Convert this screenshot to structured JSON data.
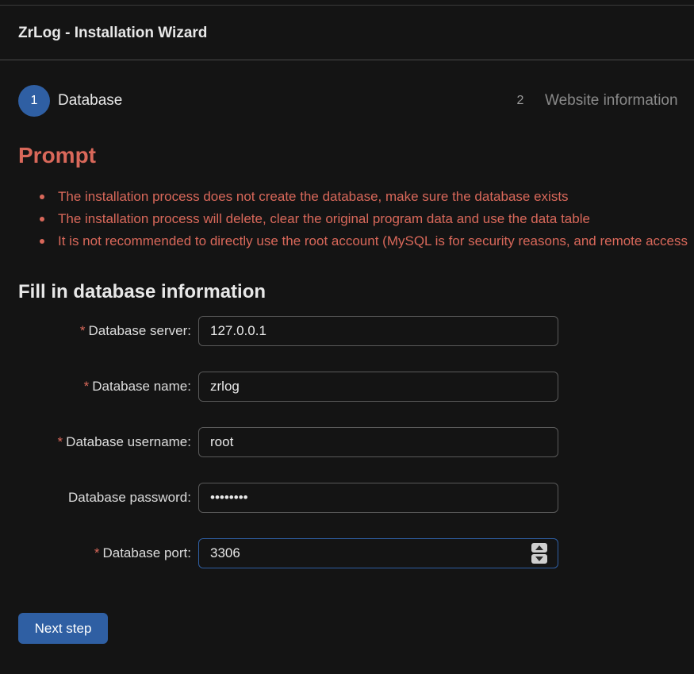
{
  "header": {
    "title": "ZrLog - Installation Wizard"
  },
  "steps": [
    {
      "number": "1",
      "label": "Database",
      "active": true
    },
    {
      "number": "2",
      "label": "Website information",
      "active": false
    }
  ],
  "prompt": {
    "title": "Prompt",
    "items": [
      "The installation process does not create the database, make sure the database exists",
      "The installation process will delete, clear the original program data and use the data table",
      "It is not recommended to directly use the root account (MySQL is for security reasons, and remote access"
    ]
  },
  "form": {
    "title": "Fill in database information",
    "required_mark": "*",
    "fields": {
      "server": {
        "label": "Database server",
        "value": "127.0.0.1",
        "required": true
      },
      "name": {
        "label": "Database name",
        "value": "zrlog",
        "required": true
      },
      "username": {
        "label": "Database username",
        "value": "root",
        "required": true
      },
      "password": {
        "label": "Database password",
        "value": "••••••••",
        "required": false
      },
      "port": {
        "label": "Database port",
        "value": "3306",
        "required": true
      }
    },
    "label_suffix": ":"
  },
  "actions": {
    "next_label": "Next step"
  },
  "colors": {
    "accent": "#2f5fa3",
    "warning": "#d9685a",
    "background": "#141414"
  }
}
